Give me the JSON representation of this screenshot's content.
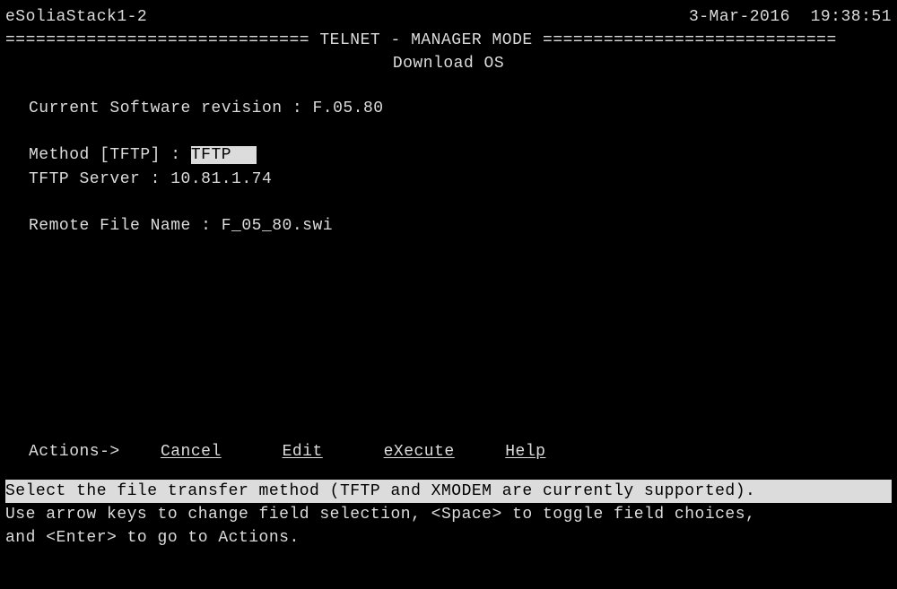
{
  "header": {
    "hostname": "eSoliaStack1-2",
    "date": "3-Mar-2016",
    "time": "19:38:51"
  },
  "title": {
    "rule_left": "==============================",
    "main": " TELNET - MANAGER MODE ",
    "rule_right": "=============================",
    "subtitle": "Download OS"
  },
  "fields": {
    "current_sw_label": "Current Software revision :",
    "current_sw_value": "F.05.80",
    "method_label": "Method [TFTP] :",
    "method_value": "TFTP",
    "tftp_server_label": "TFTP Server :",
    "tftp_server_value": "10.81.1.74",
    "remote_file_label": "Remote File Name :",
    "remote_file_value": "F_05_80.swi"
  },
  "actions": {
    "prefix": "Actions->",
    "cancel": "Cancel",
    "edit": "Edit",
    "execute": "eXecute",
    "help": "Help"
  },
  "status": {
    "highlighted": "Select the file transfer method (TFTP and XMODEM are currently supported).     ",
    "instruction1": "Use arrow keys to change field selection, <Space> to toggle field choices,",
    "instruction2": "and <Enter> to go to Actions."
  }
}
